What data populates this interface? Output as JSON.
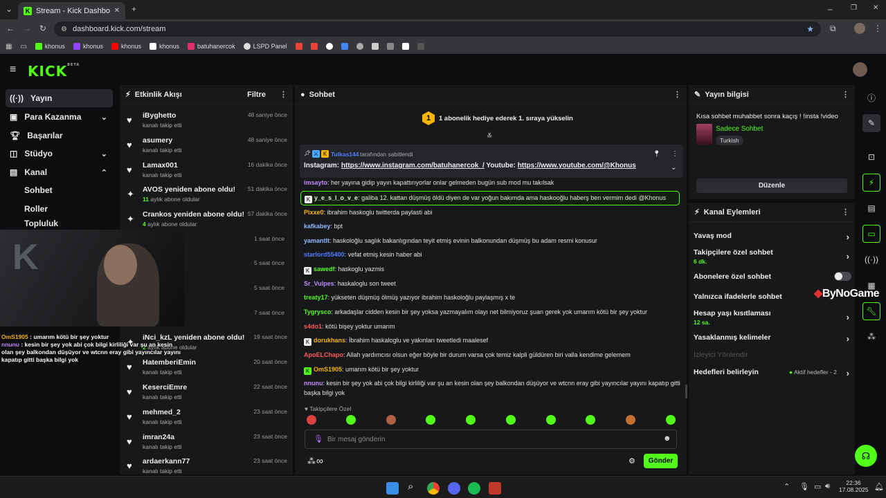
{
  "browser": {
    "tab_title": "Stream - Kick Dashboard",
    "url": "dashboard.kick.com/stream",
    "bookmarks": [
      {
        "label": "khonus",
        "color": "#53fc18"
      },
      {
        "label": "khonus",
        "color": "#9146ff"
      },
      {
        "label": "khonus",
        "color": "#ff0000"
      },
      {
        "label": "khonus",
        "color": "#ffffff"
      },
      {
        "label": "batuhanercok",
        "color": "#e1306c"
      },
      {
        "label": "LSPD Panel",
        "color": "#dddddd"
      }
    ]
  },
  "sidebar": {
    "items": [
      {
        "label": "Yayın",
        "icon": "broadcast-icon"
      },
      {
        "label": "Para Kazanma",
        "icon": "money-icon"
      },
      {
        "label": "Başarılar",
        "icon": "trophy-icon"
      },
      {
        "label": "Stüdyo",
        "icon": "studio-icon"
      },
      {
        "label": "Kanal",
        "icon": "channel-icon"
      },
      {
        "label": "Sohbet"
      },
      {
        "label": "Roller"
      },
      {
        "label": "Topluluk"
      }
    ]
  },
  "activity": {
    "title": "Etkinlik Akışı",
    "filter_label": "Filtre",
    "items": [
      {
        "name": "iByghetto",
        "sub": "kanalı takip etti",
        "time": "48 saniye önce"
      },
      {
        "name": "asumery",
        "sub": "kanalı takip etti",
        "time": "48 saniye önce"
      },
      {
        "name": "Lamax001",
        "sub": "kanalı takip etti",
        "time": "16 dakika önce"
      },
      {
        "name": "AVOS yeniden abone oldu!",
        "count": "11",
        "sub": "aylık abone oldular",
        "time": "51 dakika önce"
      },
      {
        "name": "Crankos yeniden abone oldu!",
        "count": "4",
        "sub": "aylık abone oldular",
        "time": "57 dakika önce"
      },
      {
        "name": "",
        "sub": "",
        "time": "1 saat önce"
      },
      {
        "name": "",
        "sub": "",
        "time": "5 saat önce"
      },
      {
        "name": "",
        "sub": "",
        "time": "5 saat önce"
      },
      {
        "name": "",
        "sub": "",
        "time": "7 saat önce"
      },
      {
        "name": "iNci_kzL yeniden abone oldu!",
        "count": "2",
        "sub": "aylık abone oldular",
        "time": "19 saat önce"
      },
      {
        "name": "HatemberiEmin",
        "sub": "kanalı takip etti",
        "time": "20 saat önce"
      },
      {
        "name": "KeserciEmre",
        "sub": "kanalı takip etti",
        "time": "22 saat önce"
      },
      {
        "name": "mehmed_2",
        "sub": "kanalı takip etti",
        "time": "23 saat önce"
      },
      {
        "name": "imran24a",
        "sub": "kanalı takip etti",
        "time": "23 saat önce"
      },
      {
        "name": "ardaerkann77",
        "sub": "kanalı takip etti",
        "time": "23 saat önce"
      }
    ]
  },
  "chat": {
    "title": "Sohbet",
    "banner_number": "1",
    "banner": "1 abonelik hediye ederek 1. sıraya yükselin",
    "pinned_by_user": "Tulkas144",
    "pinned_by_text": "tarafından sabitlendi",
    "pinned_prefix1": "Instagram: ",
    "pinned_link1": "https://www.instagram.com/batuhanercok_/",
    "pinned_prefix2": " Youtube: ",
    "pinned_link2": "https://www.youtube.com/@Khonus",
    "messages": [
      {
        "user": "imsayto",
        "color": "#c08bff",
        "text": "her yayına gidip yayın kapattırıyorlar onlar gelmeden bugün sub mod mu takılsak"
      },
      {
        "user": "y_e_s_l_o_v_e",
        "color": "#e6e8ea",
        "text": "galiba 12. kattan düşmüş öldü diyen de var yoğun bakımda ama haskooğlu haberş ben vermim dedi @Khonus",
        "highlight": true
      },
      {
        "user": "Pixxe0",
        "color": "#f7b500",
        "text": "ibrahim haskoglu twitterda paylasti abi"
      },
      {
        "user": "kafkabey",
        "color": "#8fb8ff",
        "text": "bpt"
      },
      {
        "user": "yamantlt",
        "color": "#8fb8ff",
        "text": "haskoloğlu saglık bakanlıgından teyit etmiş evinin balkonundan düşmüş bu adam resmi konusur"
      },
      {
        "user": "starlord55400",
        "color": "#4f7bff",
        "text": "vefat etmiş kesin haber abi"
      },
      {
        "user": "sawedf",
        "color": "#53fc18",
        "text": "haskoglu yazmis"
      },
      {
        "user": "Sr_Vulpes",
        "color": "#c08bff",
        "text": "haskaloglu son tweet"
      },
      {
        "user": "treaty17",
        "color": "#53fc18",
        "text": "yükseten düşmüş ölmüş yazıyor ibrahim haskoloğlu paylaşmış x te"
      },
      {
        "user": "Tygrysco",
        "color": "#53fc18",
        "text": "arkadaşlar cidden kesin bir şey yoksa yazmayalım olayı net bilmiyoruz şuan gerek yok umarım kötü bir şey yoktur"
      },
      {
        "user": "s4do1",
        "color": "#ff5a5a",
        "text": "kötü bişey yoktur umarım"
      },
      {
        "user": "dorukhans",
        "color": "#f7b500",
        "text": "İbrahim haskaloglu ve yakınları tweetledi maalesef"
      },
      {
        "user": "ApoELChapo",
        "color": "#ff5a5a",
        "text": "Allah yardımcısı olsun eğer böyle bir durum varsa çok temiz kalpli güldüren biri valla kendime gelemem"
      },
      {
        "user": "OmS1905",
        "color": "#f7b500",
        "text": "umarım kötü bir şey yoktur"
      },
      {
        "user": "nnunu",
        "color": "#c08bff",
        "text": "kesin bir şey yok abi çok bilgi kirliliği var şu an kesin olan şey balkondan düşüyor ve wtcnn eray gibi yayıncılar yayını kapatıp gitti başka bilgi yok"
      }
    ],
    "followers_only_label": "Takipçilere Özel",
    "input_placeholder": "Bir mesaj gönderin",
    "send_label": "Gönder"
  },
  "stream_info": {
    "title": "Yayın bilgisi",
    "stream_title": "Kısa sohbet muhabbet sonra kaçış ! !insta !video",
    "category": "Sadece Sohbet",
    "tag": "Turkish",
    "edit_label": "Düzenle"
  },
  "channel_actions": {
    "title": "Kanal Eylemleri",
    "items": [
      {
        "label": "Yavaş mod",
        "sub": ""
      },
      {
        "label": "Takipçilere özel sohbet",
        "sub": "6 dk."
      },
      {
        "label": "Abonelere özel sohbet",
        "sub": ""
      },
      {
        "label": "Yalnızca ifadelerle sohbet",
        "sub": ""
      },
      {
        "label": "Hesap yaşı kısıtlaması",
        "sub": "12 sa."
      },
      {
        "label": "Yasaklanmış kelimeler",
        "sub": ""
      },
      {
        "label": "İzleyici Yönlendir",
        "sub": ""
      },
      {
        "label": "Hedefleri belirleyin",
        "sub": ""
      }
    ],
    "goals_status": "Aktif hedefler - 2"
  },
  "overlay": {
    "watermark": "ByNoGame",
    "cam_chat": [
      {
        "user": "OmS1905",
        "text": "umarım kötü bir şey yoktur"
      },
      {
        "user": "nnunu",
        "text": "kesin bir şey yok abi çok bilgi kirliliği var şu an kesin olan şey balkondan düşüyor ve wtcnn eray gibi yayıncılar yayını kapatıp gitti başka bilgi yok"
      }
    ]
  },
  "taskbar": {
    "time": "22:36",
    "date": "17.08.2025"
  },
  "colors": {
    "accent": "#53fc18",
    "panel": "#17181a",
    "bg": "#0c0d0e"
  }
}
